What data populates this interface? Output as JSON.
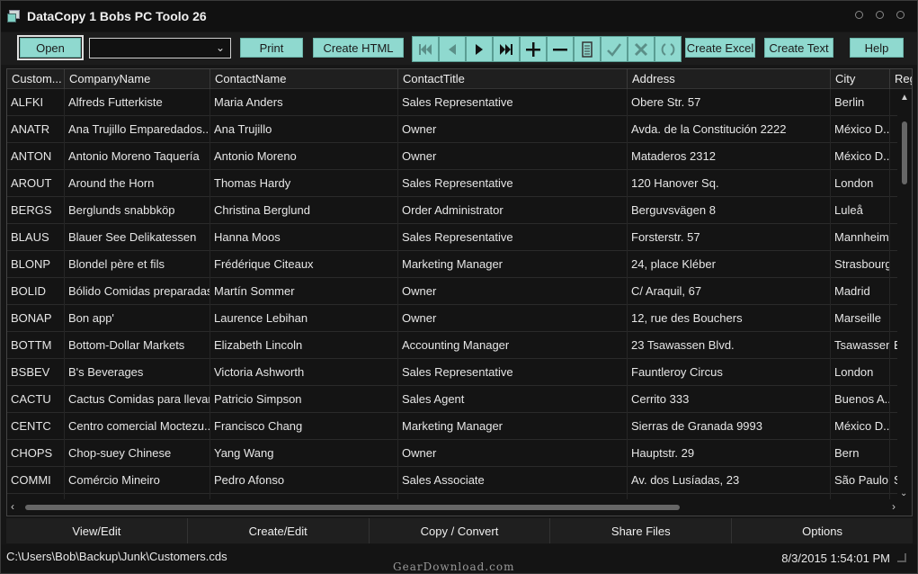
{
  "window": {
    "title": "DataCopy 1 Bobs PC Toolo 26"
  },
  "toolbar": {
    "open_label": "Open",
    "combo_value": "",
    "print_label": "Print",
    "create_html_label": "Create HTML",
    "create_excel_label": "Create Excel",
    "create_text_label": "Create Text",
    "help_label": "Help",
    "nav_icons": [
      "first-record-icon",
      "prev-record-icon",
      "next-record-icon",
      "last-record-icon",
      "add-record-icon",
      "delete-record-icon",
      "edit-record-icon",
      "post-record-icon",
      "cancel-record-icon",
      "refresh-icon"
    ]
  },
  "grid": {
    "columns": [
      "Custom...",
      "CompanyName",
      "ContactName",
      "ContactTitle",
      "Address",
      "City",
      "Reg"
    ],
    "rows": [
      [
        "ALFKI",
        "Alfreds Futterkiste",
        "Maria Anders",
        "Sales Representative",
        "Obere Str. 57",
        "Berlin",
        ""
      ],
      [
        "ANATR",
        "Ana Trujillo Emparedados...",
        "Ana Trujillo",
        "Owner",
        "Avda. de la Constitución 2222",
        "México D...",
        ""
      ],
      [
        "ANTON",
        "Antonio Moreno Taquería",
        "Antonio Moreno",
        "Owner",
        "Mataderos  2312",
        "México D...",
        ""
      ],
      [
        "AROUT",
        "Around the Horn",
        "Thomas Hardy",
        "Sales Representative",
        "120 Hanover Sq.",
        "London",
        ""
      ],
      [
        "BERGS",
        "Berglunds snabbköp",
        "Christina Berglund",
        "Order Administrator",
        "Berguvsvägen  8",
        "Luleå",
        ""
      ],
      [
        "BLAUS",
        "Blauer See Delikatessen",
        "Hanna Moos",
        "Sales Representative",
        "Forsterstr. 57",
        "Mannheim",
        ""
      ],
      [
        "BLONP",
        "Blondel père et fils",
        "Frédérique Citeaux",
        "Marketing Manager",
        "24, place Kléber",
        "Strasbourg",
        ""
      ],
      [
        "BOLID",
        "Bólido Comidas preparadas",
        "Martín Sommer",
        "Owner",
        "C/ Araquil, 67",
        "Madrid",
        ""
      ],
      [
        "BONAP",
        "Bon app'",
        "Laurence Lebihan",
        "Owner",
        "12, rue des Bouchers",
        "Marseille",
        ""
      ],
      [
        "BOTTM",
        "Bottom-Dollar Markets",
        "Elizabeth Lincoln",
        "Accounting Manager",
        "23 Tsawassen Blvd.",
        "Tsawassen",
        "B"
      ],
      [
        "BSBEV",
        "B's Beverages",
        "Victoria Ashworth",
        "Sales Representative",
        "Fauntleroy Circus",
        "London",
        ""
      ],
      [
        "CACTU",
        "Cactus Comidas para llevar",
        "Patricio Simpson",
        "Sales Agent",
        "Cerrito 333",
        "Buenos A...",
        ""
      ],
      [
        "CENTC",
        "Centro comercial Moctezu...",
        "Francisco Chang",
        "Marketing Manager",
        "Sierras de Granada 9993",
        "México D...",
        ""
      ],
      [
        "CHOPS",
        "Chop-suey Chinese",
        "Yang Wang",
        "Owner",
        "Hauptstr. 29",
        "Bern",
        ""
      ],
      [
        "COMMI",
        "Comércio Mineiro",
        "Pedro Afonso",
        "Sales Associate",
        "Av. dos Lusíadas, 23",
        "São Paulo",
        "S"
      ],
      [
        "",
        "",
        "",
        "",
        "",
        "",
        ""
      ]
    ]
  },
  "tabs": [
    "View/Edit",
    "Create/Edit",
    "Copy / Convert",
    "Share Files",
    "Options"
  ],
  "status": {
    "path": "C:\\Users\\Bob\\Backup\\Junk\\Customers.cds",
    "datetime": "8/3/2015 1:54:01 PM"
  },
  "watermark": "GearDownload.com",
  "colors": {
    "accent": "#8fd9cf",
    "background": "#141414"
  }
}
